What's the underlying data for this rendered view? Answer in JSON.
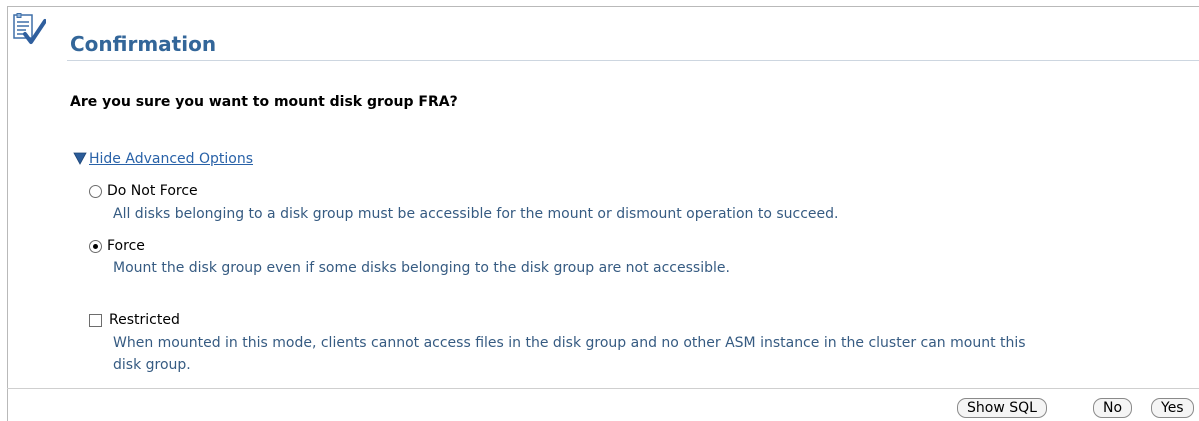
{
  "header": {
    "icon": "confirmation-document-check-icon",
    "title": "Confirmation"
  },
  "question": "Are you sure you want to mount disk group FRA?",
  "advanced": {
    "icon": "expanded-triangle-icon",
    "toggle_label": "Hide Advanced Options"
  },
  "options": [
    {
      "label": "Do Not Force",
      "description": "All disks belonging to a disk group must be accessible for the mount or dismount operation to succeed.",
      "checked": false
    },
    {
      "label": "Force",
      "description": "Mount the disk group even if some disks belonging to the disk group are not accessible.",
      "checked": true
    }
  ],
  "restricted": {
    "label": "Restricted",
    "checked": false,
    "description_line1": "When mounted in this mode, clients cannot access files in the disk group and no other ASM instance in the cluster can mount this",
    "description_line2": "disk group."
  },
  "buttons": {
    "show_sql": "Show SQL",
    "no": "No",
    "yes": "Yes"
  },
  "colors": {
    "title": "#336699",
    "link": "#2962a8",
    "description": "#365b82"
  }
}
